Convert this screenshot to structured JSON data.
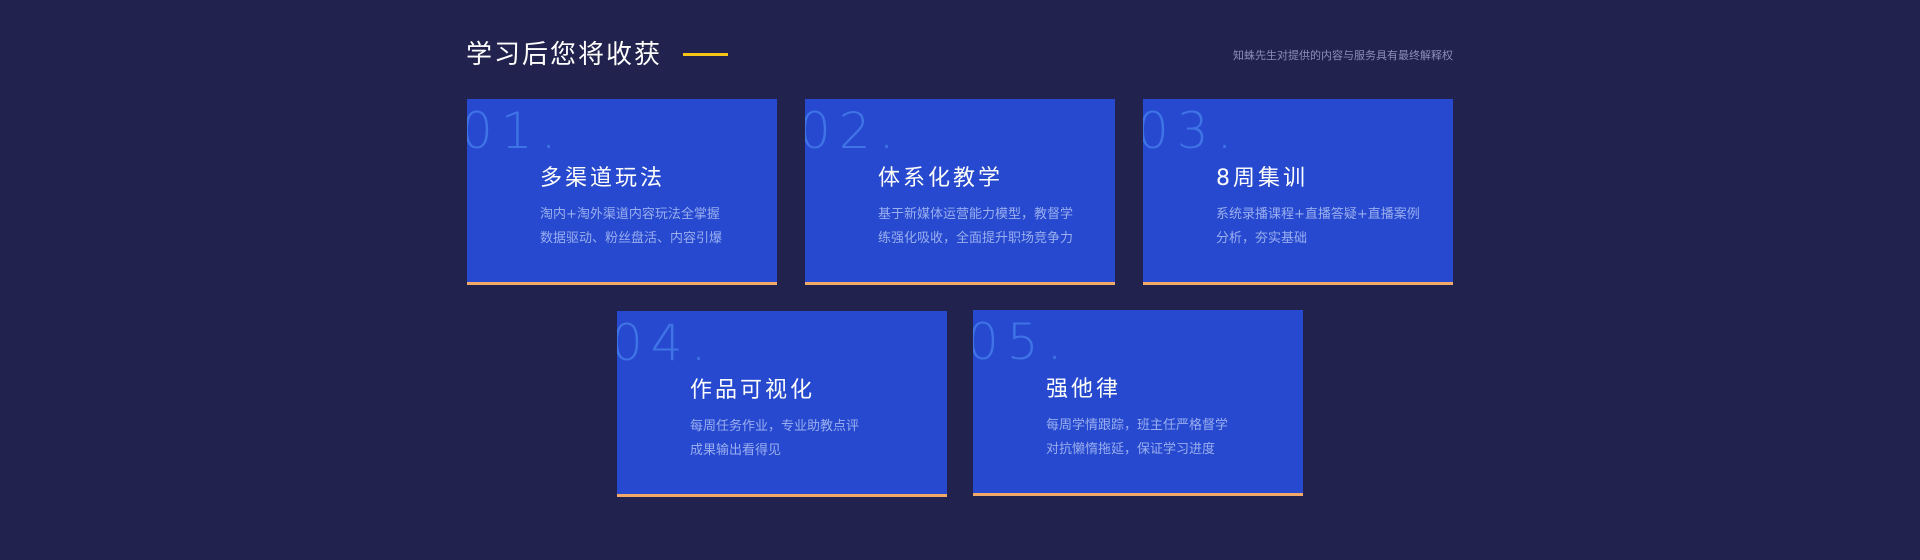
{
  "header": {
    "title": "学习后您将收获",
    "disclaimer": "知蛛先生对提供的内容与服务具有最终解释权",
    "accent_color": "#f5c518"
  },
  "cards": [
    {
      "number": "01.",
      "title": "多渠道玩法",
      "desc_line1": "淘内+淘外渠道内容玩法全掌握",
      "desc_line2": "数据驱动、粉丝盘活、内容引爆"
    },
    {
      "number": "02.",
      "title": "体系化教学",
      "desc_line1": "基于新媒体运营能力模型，教督学",
      "desc_line2": "练强化吸收，全面提升职场竞争力"
    },
    {
      "number": "03.",
      "title": "8周集训",
      "desc_line1": "系统录播课程+直播答疑+直播案例",
      "desc_line2": "分析，夯实基础"
    },
    {
      "number": "04.",
      "title": "作品可视化",
      "desc_line1": "每周任务作业，专业助教点评",
      "desc_line2": "成果输出看得见"
    },
    {
      "number": "05.",
      "title": "强他律",
      "desc_line1": "每周学情跟踪，班主任严格督学",
      "desc_line2": "对抗懒惰拖延，保证学习进度"
    }
  ],
  "colors": {
    "background": "#22224f",
    "card": "#2649cf",
    "card_number": "#3f73e6",
    "card_border": "#f2a867",
    "desc_text": "#9aaef0"
  }
}
